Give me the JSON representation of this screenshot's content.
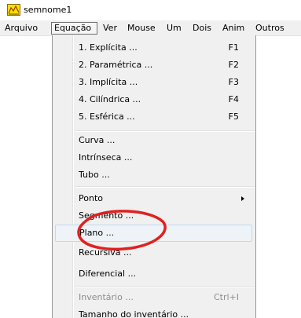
{
  "window": {
    "title": "semnome1"
  },
  "menubar": {
    "items": [
      "Arquivo",
      "Equação",
      "Ver",
      "Mouse",
      "Um",
      "Dois",
      "Anim",
      "Outros"
    ]
  },
  "dropdown": {
    "items": [
      {
        "label": "1. Explícita ...",
        "shortcut": "F1"
      },
      {
        "label": "2. Paramétrica ...",
        "shortcut": "F2"
      },
      {
        "label": "3. Implícita ...",
        "shortcut": "F3"
      },
      {
        "label": "4. Cilíndrica ...",
        "shortcut": "F4"
      },
      {
        "label": "5. Esférica ...",
        "shortcut": "F5"
      },
      {
        "label": "Curva ..."
      },
      {
        "label": "Intrínseca ..."
      },
      {
        "label": "Tubo ..."
      },
      {
        "label": "Ponto"
      },
      {
        "label": "Segmento ..."
      },
      {
        "label": "Plano ..."
      },
      {
        "label": "Recursiva ..."
      },
      {
        "label": "Diferencial ..."
      },
      {
        "label": "Inventário ...",
        "shortcut": "Ctrl+I"
      },
      {
        "label": "Tamanho do inventário ..."
      }
    ]
  },
  "annotation": {
    "color": "#e02020"
  },
  "colors": {
    "menu_background": "#f0f0f0",
    "highlight_background": "#eef3f8",
    "highlight_border": "#c1d9f1",
    "disabled_text": "#8d8d8d"
  }
}
